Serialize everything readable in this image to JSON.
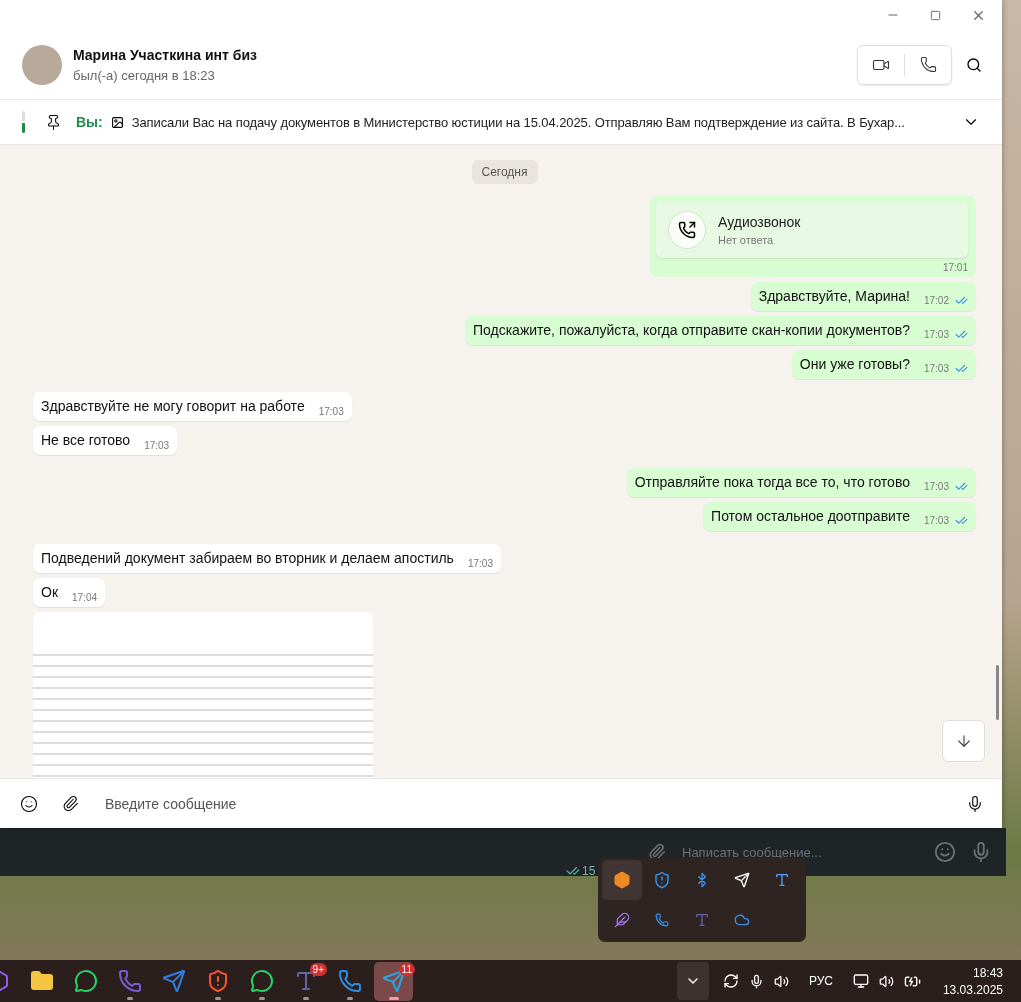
{
  "chat_header": {
    "name": "Марина Участкина инт биз",
    "status": "был(-а) сегодня в 18:23"
  },
  "pinned": {
    "sender": "Вы:",
    "text": "Записали Вас на подачу документов в Министерство юстиции на 15.04.2025. Отправляю Вам подтверждение из сайта.  В Бухар..."
  },
  "date_divider": "Сегодня",
  "messages": [
    {
      "kind": "call",
      "outgoing": true,
      "title": "Аудиозвонок",
      "subtitle": "Нет ответа",
      "time": "17:01"
    },
    {
      "kind": "text",
      "outgoing": true,
      "text": "Здравствуйте, Марина!",
      "time": "17:02",
      "read": true
    },
    {
      "kind": "text",
      "outgoing": true,
      "text": "Подскажите, пожалуйста, когда отправите скан-копии документов?",
      "time": "17:03",
      "read": true
    },
    {
      "kind": "text",
      "outgoing": true,
      "text": "Они уже готовы?",
      "time": "17:03",
      "read": true
    },
    {
      "kind": "text",
      "outgoing": false,
      "text": "Здравствуйте не могу говорит на работе",
      "time": "17:03"
    },
    {
      "kind": "text",
      "outgoing": false,
      "text": "Не все готово",
      "time": "17:03"
    },
    {
      "kind": "text",
      "outgoing": true,
      "text": "Отправляйте пока тогда все то, что готово",
      "time": "17:03",
      "read": true
    },
    {
      "kind": "text",
      "outgoing": true,
      "text": "Потом остальное доотправите",
      "time": "17:03",
      "read": true
    },
    {
      "kind": "text",
      "outgoing": false,
      "text": "Подведений документ забираем во вторник и делаем апостиль",
      "time": "17:03"
    },
    {
      "kind": "text",
      "outgoing": false,
      "text": "Ок",
      "time": "17:04"
    },
    {
      "kind": "photo",
      "outgoing": false
    }
  ],
  "composer": {
    "placeholder": "Введите сообщение"
  },
  "background_window": {
    "placeholder": "Написать сообщение...",
    "time": "15"
  },
  "taskbar": {
    "apps": [
      {
        "kind": "copilot",
        "running": false,
        "selected": false
      },
      {
        "kind": "files",
        "running": false,
        "selected": false
      },
      {
        "kind": "whatsapp",
        "running": false,
        "selected": false
      },
      {
        "kind": "viber",
        "running": true,
        "selected": false
      },
      {
        "kind": "thunderbird",
        "running": false,
        "selected": false
      },
      {
        "kind": "brave",
        "running": true,
        "selected": false
      },
      {
        "kind": "whatsapp",
        "running": true,
        "selected": false
      },
      {
        "kind": "teams",
        "running": true,
        "selected": false,
        "badge": "9+"
      },
      {
        "kind": "phone",
        "running": true,
        "selected": false
      },
      {
        "kind": "telegram",
        "running": true,
        "selected": true,
        "badge": "11"
      }
    ],
    "language": "РУС",
    "time": "18:43",
    "date": "13.03.2025"
  }
}
